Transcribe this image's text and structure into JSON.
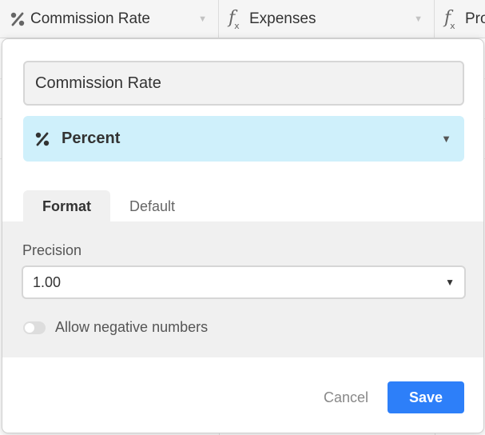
{
  "grid": {
    "columns": [
      {
        "label": "Commission Rate",
        "icon": "percent-icon"
      },
      {
        "label": "Expenses",
        "icon": "formula-icon"
      },
      {
        "label": "Pro",
        "icon": "formula-icon"
      }
    ]
  },
  "field_editor": {
    "name_value": "Commission Rate",
    "field_type": {
      "label": "Percent",
      "icon": "percent-icon",
      "background": "#cff0fb"
    },
    "tabs": [
      {
        "label": "Format",
        "active": true
      },
      {
        "label": "Default",
        "active": false
      }
    ],
    "precision": {
      "label": "Precision",
      "value": "1.00"
    },
    "allow_negative": {
      "label": "Allow negative numbers",
      "enabled": false
    },
    "cancel_label": "Cancel",
    "save_label": "Save"
  },
  "colors": {
    "accent": "#2d7ff9",
    "type_highlight": "#cff0fb",
    "panel_bg": "#f0f0f0"
  }
}
